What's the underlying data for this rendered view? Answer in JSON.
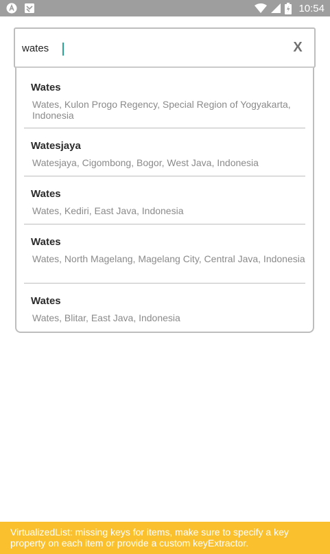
{
  "status_bar": {
    "time": "10:54",
    "left_icons": [
      "app-notification-icon",
      "download-notification-icon"
    ],
    "right_icons": [
      "wifi-icon",
      "signal-icon",
      "battery-icon"
    ]
  },
  "search": {
    "value": "wates",
    "clear_label": "X"
  },
  "results": [
    {
      "title": "Wates",
      "subtitle": "Wates, Kulon Progo Regency, Special Region of Yogyakarta, Indonesia"
    },
    {
      "title": "Watesjaya",
      "subtitle": "Watesjaya, Cigombong, Bogor, West Java, Indonesia"
    },
    {
      "title": "Wates",
      "subtitle": "Wates, Kediri, East Java, Indonesia"
    },
    {
      "title": "Wates",
      "subtitle": "Wates, North Magelang, Magelang City, Central Java, Indonesia"
    },
    {
      "title": "Wates",
      "subtitle": "Wates, Blitar, East Java, Indonesia"
    }
  ],
  "warning": {
    "text": "VirtualizedList: missing keys for items, make sure to specify a key property on each item or provide a custom keyExtractor."
  },
  "colors": {
    "status_bar": "#9e9e9e",
    "warning_bg": "#fbc02d",
    "caret": "#26a69a"
  }
}
